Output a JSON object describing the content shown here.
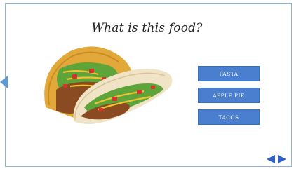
{
  "question": "What is this food?",
  "image": {
    "subject": "tacos-photo"
  },
  "answers": [
    {
      "label": "PASTA"
    },
    {
      "label": "APPLE PIE"
    },
    {
      "label": "TACOS"
    }
  ],
  "navigation": {
    "prev_icon": "triangle-left",
    "next_icon": "triangle-right"
  },
  "colors": {
    "button_bg": "#4a7fd0",
    "nav": "#2e62c7",
    "frame": "#8fb3d9"
  }
}
